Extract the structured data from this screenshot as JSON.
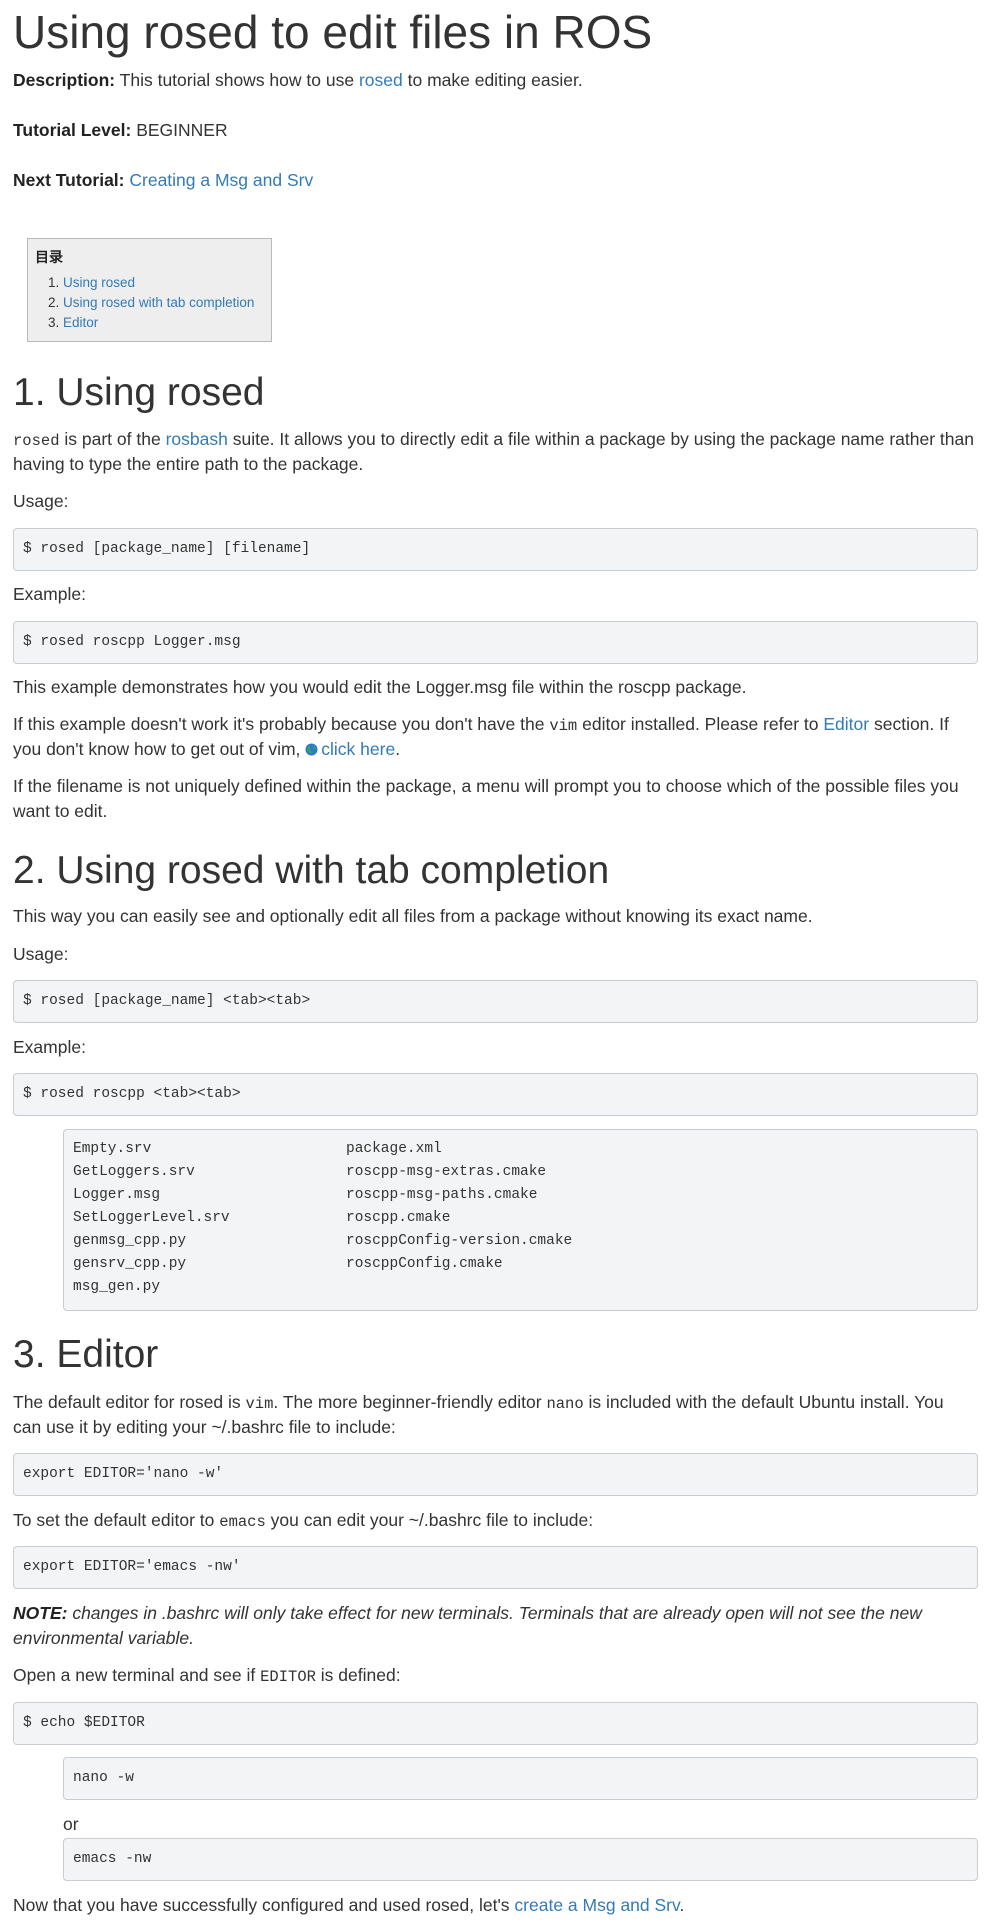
{
  "title": "Using rosed to edit files in ROS",
  "meta": {
    "description_label": "Description:",
    "description_pre": "This tutorial shows how to use",
    "description_link": "rosed",
    "description_post": "to make editing easier.",
    "level_label": "Tutorial Level:",
    "level_value": "BEGINNER",
    "next_label": "Next Tutorial:",
    "next_link": "Creating a Msg and Srv"
  },
  "toc": {
    "heading": "目录",
    "items": [
      {
        "num": "1.",
        "label": "Using rosed"
      },
      {
        "num": "2.",
        "label": "Using rosed with tab completion"
      },
      {
        "num": "3.",
        "label": "Editor"
      }
    ]
  },
  "section1": {
    "heading": "1. Using rosed",
    "p1_code": "rosed",
    "p1_a": "is part of the",
    "p1_link": "rosbash",
    "p1_b": "suite. It allows you to directly edit a file within a package by using the package name rather than",
    "p1_c": "having to type the entire path to the package.",
    "usage_label": "Usage:",
    "usage_code": "$ rosed [package_name] [filename]",
    "example_label": "Example:",
    "example_code": "$ rosed roscpp Logger.msg",
    "p2": "This example demonstrates how you would edit the Logger.msg file within the roscpp package.",
    "p3_a": "If this example doesn't work it's probably because you don't have the",
    "p3_code": "vim",
    "p3_b": "editor installed. Please refer to",
    "p3_link": "Editor",
    "p3_c": "section. If",
    "p3_d": "you don't know how to get out of vim,",
    "p3_link2": "click here",
    "p3_e": ".",
    "p4_a": "If the filename is not uniquely defined within the package, a menu will prompt you to choose which of the possible files you",
    "p4_b": "want to edit."
  },
  "section2": {
    "heading": "2. Using rosed with tab completion",
    "p1": "This way you can easily see and optionally edit all files from a package without knowing its exact name.",
    "usage_label": "Usage:",
    "usage_code": "$ rosed [package_name] <tab><tab>",
    "example_label": "Example:",
    "example_code": "$ rosed roscpp <tab><tab>",
    "files_col1": [
      "Empty.srv",
      "GetLoggers.srv",
      "Logger.msg",
      "SetLoggerLevel.srv",
      "genmsg_cpp.py",
      "gensrv_cpp.py",
      "msg_gen.py"
    ],
    "files_col2": [
      "package.xml",
      "roscpp-msg-extras.cmake",
      "roscpp-msg-paths.cmake",
      "roscpp.cmake",
      "roscppConfig-version.cmake",
      "roscppConfig.cmake"
    ]
  },
  "section3": {
    "heading": "3. Editor",
    "p1_a": "The default editor for rosed is",
    "p1_code": "vim",
    "p1_b": ". The more beginner-friendly editor",
    "p1_code2": "nano",
    "p1_c": "is included with the default Ubuntu install. You",
    "p1_d": "can use it by editing your ~/.bashrc file to include:",
    "code1": "export EDITOR='nano -w'",
    "p2_a": "To set the default editor to",
    "p2_code": "emacs",
    "p2_b": "you can edit your ~/.bashrc file to include:",
    "code2": "export EDITOR='emacs -nw'",
    "note_label": "NOTE:",
    "note_a": "changes in .bashrc will only take effect for new terminals. Terminals that are already open will not see the new",
    "note_b": "environmental variable.",
    "p3_a": "Open a new terminal and see if",
    "p3_code": "EDITOR",
    "p3_b": "is defined:",
    "code3": "$ echo $EDITOR",
    "out1": "nano -w",
    "or": "or",
    "out2": "emacs -nw",
    "final_a": "Now that you have successfully configured and used rosed, let's",
    "final_link": "create a Msg and Srv",
    "final_b": "."
  }
}
